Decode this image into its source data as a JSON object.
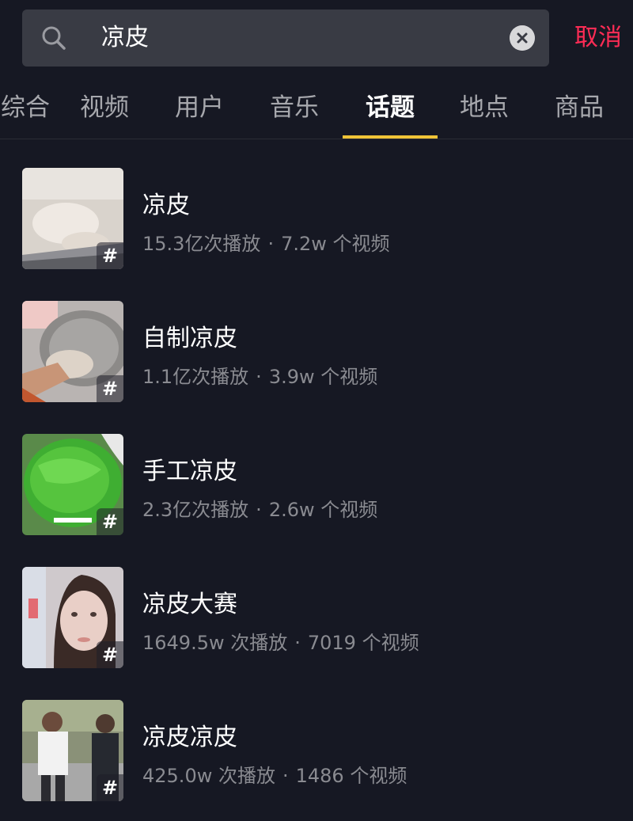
{
  "search": {
    "query": "凉皮",
    "cancel_label": "取消",
    "cancel_color": "#fe2c55"
  },
  "tabs": [
    {
      "label": "综合",
      "active": false
    },
    {
      "label": "视频",
      "active": false
    },
    {
      "label": "用户",
      "active": false
    },
    {
      "label": "音乐",
      "active": false
    },
    {
      "label": "话题",
      "active": true
    },
    {
      "label": "地点",
      "active": false
    },
    {
      "label": "商品",
      "active": false
    }
  ],
  "topic_badge": "#",
  "results": [
    {
      "title": "凉皮",
      "plays": "15.3亿次播放",
      "separator": "·",
      "videos": "7.2w 个视频"
    },
    {
      "title": "自制凉皮",
      "plays": "1.1亿次播放",
      "separator": "·",
      "videos": "3.9w 个视频"
    },
    {
      "title": "手工凉皮",
      "plays": "2.3亿次播放",
      "separator": "·",
      "videos": "2.6w 个视频"
    },
    {
      "title": "凉皮大赛",
      "plays": "1649.5w 次播放",
      "separator": "·",
      "videos": "7019 个视频"
    },
    {
      "title": "凉皮凉皮",
      "plays": "425.0w 次播放",
      "separator": "·",
      "videos": "1486 个视频"
    }
  ],
  "colors": {
    "background": "#161823",
    "accent_underline": "#f0c437",
    "search_box": "#393b44"
  }
}
